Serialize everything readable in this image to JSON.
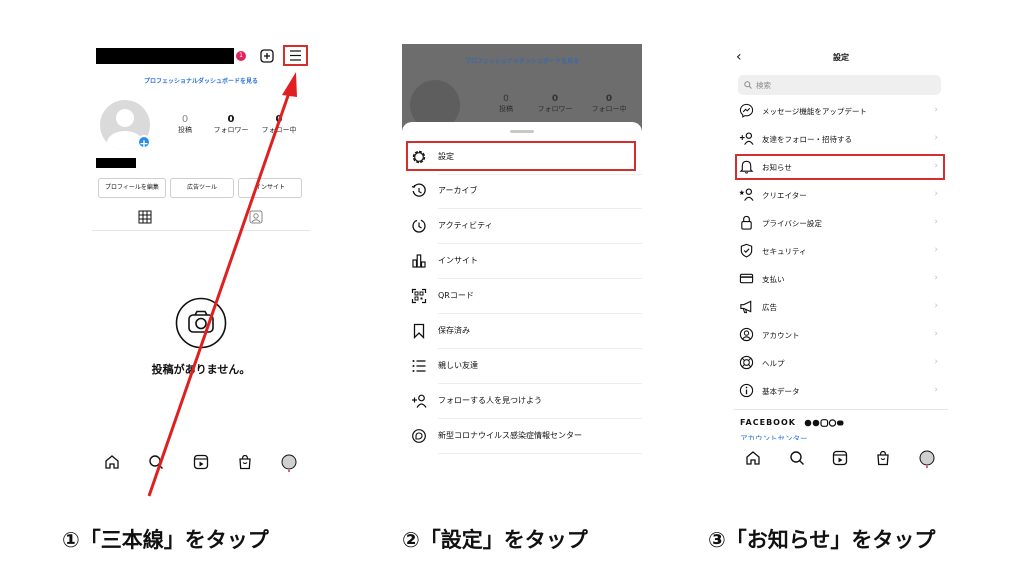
{
  "panel1": {
    "notification_count": "1",
    "dashboard_link": "プロフェッショナルダッシュボードを見る",
    "stats": [
      {
        "value": "0",
        "label": "投稿"
      },
      {
        "value": "0",
        "label": "フォロワー"
      },
      {
        "value": "0",
        "label": "フォロー中"
      }
    ],
    "buttons": {
      "edit_profile": "プロフィールを編集",
      "ad_tools": "広告ツール",
      "insights": "インサイト"
    },
    "empty_state": "投稿がありません。"
  },
  "panel2": {
    "dashboard_link": "プロフェッショナルダッシュボードを見る",
    "stats": [
      {
        "value": "0",
        "label": "投稿"
      },
      {
        "value": "0",
        "label": "フォロワー"
      },
      {
        "value": "0",
        "label": "フォロー中"
      }
    ],
    "menu": [
      {
        "label": "設定",
        "icon": "settings-gear-icon"
      },
      {
        "label": "アーカイブ",
        "icon": "archive-icon"
      },
      {
        "label": "アクティビティ",
        "icon": "activity-clock-icon"
      },
      {
        "label": "インサイト",
        "icon": "insights-bar-icon"
      },
      {
        "label": "QRコード",
        "icon": "qr-code-icon"
      },
      {
        "label": "保存済み",
        "icon": "bookmark-icon"
      },
      {
        "label": "親しい友達",
        "icon": "close-friends-list-icon"
      },
      {
        "label": "フォローする人を見つけよう",
        "icon": "add-person-icon"
      },
      {
        "label": "新型コロナウイルス感染症情報センター",
        "icon": "covid-info-icon"
      }
    ]
  },
  "panel3": {
    "title": "設定",
    "search_placeholder": "検索",
    "items": [
      {
        "label": "メッセージ機能をアップデート",
        "icon": "messenger-icon"
      },
      {
        "label": "友達をフォロー・招待する",
        "icon": "add-person-icon"
      },
      {
        "label": "お知らせ",
        "icon": "bell-icon"
      },
      {
        "label": "クリエイター",
        "icon": "creator-icon"
      },
      {
        "label": "プライバシー設定",
        "icon": "lock-icon"
      },
      {
        "label": "セキュリティ",
        "icon": "shield-icon"
      },
      {
        "label": "支払い",
        "icon": "card-icon"
      },
      {
        "label": "広告",
        "icon": "megaphone-icon"
      },
      {
        "label": "アカウント",
        "icon": "account-icon"
      },
      {
        "label": "ヘルプ",
        "icon": "lifebuoy-icon"
      },
      {
        "label": "基本データ",
        "icon": "info-icon"
      }
    ],
    "facebook_label": "FACEBOOK",
    "account_center": "アカウントセンター"
  },
  "captions": {
    "step1": "①「三本線」をタップ",
    "step2": "②「設定」をタップ",
    "step3": "③「お知らせ」をタップ"
  },
  "colors": {
    "highlight": "#d32f2f",
    "link_blue": "#2a6fdb",
    "notification_red": "#e0245e"
  }
}
